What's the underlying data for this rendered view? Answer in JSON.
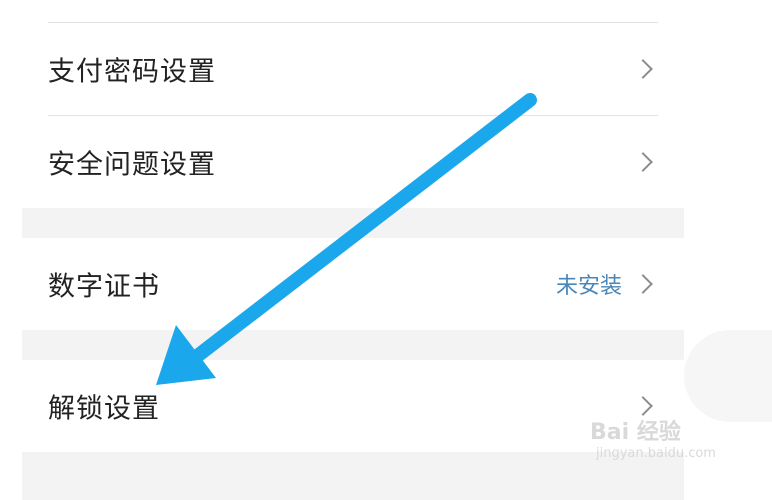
{
  "settings": {
    "rows": [
      {
        "label": "支付密码设置"
      },
      {
        "label": "安全问题设置"
      },
      {
        "label": "数字证书",
        "value": "未安装"
      },
      {
        "label": "解锁设置"
      }
    ]
  },
  "annotation": {
    "arrow_color": "#1aa7ec"
  },
  "watermark": {
    "main": "Bai 经验",
    "sub": "jingyan.baidu.com"
  }
}
